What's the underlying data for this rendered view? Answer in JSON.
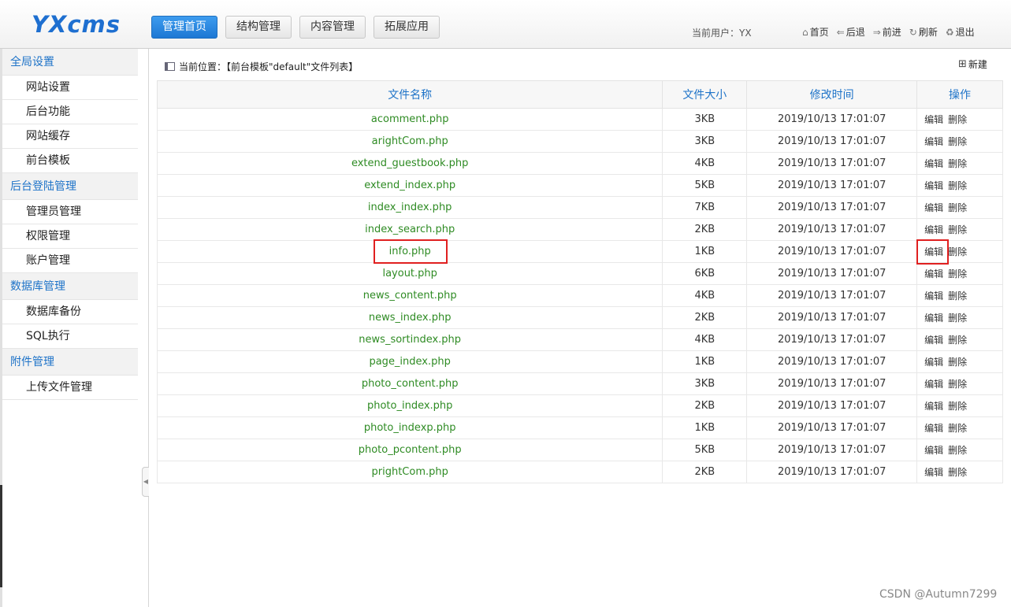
{
  "header": {
    "logo": "YXcms",
    "tabs": [
      "管理首页",
      "结构管理",
      "内容管理",
      "拓展应用"
    ],
    "current_user": "当前用户：YX",
    "toolbar": [
      {
        "icon": "home-icon",
        "glyph": "⌂",
        "label": "首页"
      },
      {
        "icon": "back-icon",
        "glyph": "⇐",
        "label": "后退"
      },
      {
        "icon": "forward-icon",
        "glyph": "⇒",
        "label": "前进"
      },
      {
        "icon": "refresh-icon",
        "glyph": "↻",
        "label": "刷新"
      },
      {
        "icon": "logout-icon",
        "glyph": "♻",
        "label": "退出"
      }
    ]
  },
  "sidebar": [
    {
      "group": "全局设置",
      "items": [
        "网站设置",
        "后台功能",
        "网站缓存",
        "前台模板"
      ]
    },
    {
      "group": "后台登陆管理",
      "items": [
        "管理员管理",
        "权限管理",
        "账户管理"
      ]
    },
    {
      "group": "数据库管理",
      "items": [
        "数据库备份",
        "SQL执行"
      ]
    },
    {
      "group": "附件管理",
      "items": [
        "上传文件管理"
      ]
    }
  ],
  "breadcrumb": "当前位置：【前台模板\"default\"文件列表】",
  "new_button": "新建",
  "table": {
    "headers": [
      "文件名称",
      "文件大小",
      "修改时间",
      "操作"
    ],
    "edit_label": "编辑",
    "delete_label": "删除",
    "rows": [
      {
        "name": "acomment.php",
        "size": "3KB",
        "time": "2019/10/13 17:01:07"
      },
      {
        "name": "arightCom.php",
        "size": "3KB",
        "time": "2019/10/13 17:01:07"
      },
      {
        "name": "extend_guestbook.php",
        "size": "4KB",
        "time": "2019/10/13 17:01:07"
      },
      {
        "name": "extend_index.php",
        "size": "5KB",
        "time": "2019/10/13 17:01:07"
      },
      {
        "name": "index_index.php",
        "size": "7KB",
        "time": "2019/10/13 17:01:07"
      },
      {
        "name": "index_search.php",
        "size": "2KB",
        "time": "2019/10/13 17:01:07"
      },
      {
        "name": "info.php",
        "size": "1KB",
        "time": "2019/10/13 17:01:07"
      },
      {
        "name": "layout.php",
        "size": "6KB",
        "time": "2019/10/13 17:01:07"
      },
      {
        "name": "news_content.php",
        "size": "4KB",
        "time": "2019/10/13 17:01:07"
      },
      {
        "name": "news_index.php",
        "size": "2KB",
        "time": "2019/10/13 17:01:07"
      },
      {
        "name": "news_sortindex.php",
        "size": "4KB",
        "time": "2019/10/13 17:01:07"
      },
      {
        "name": "page_index.php",
        "size": "1KB",
        "time": "2019/10/13 17:01:07"
      },
      {
        "name": "photo_content.php",
        "size": "3KB",
        "time": "2019/10/13 17:01:07"
      },
      {
        "name": "photo_index.php",
        "size": "2KB",
        "time": "2019/10/13 17:01:07"
      },
      {
        "name": "photo_indexp.php",
        "size": "1KB",
        "time": "2019/10/13 17:01:07"
      },
      {
        "name": "photo_pcontent.php",
        "size": "5KB",
        "time": "2019/10/13 17:01:07"
      },
      {
        "name": "prightCom.php",
        "size": "2KB",
        "time": "2019/10/13 17:01:07"
      }
    ]
  },
  "watermark": "CSDN @Autumn7299",
  "colors": {
    "accent": "#1e73c8",
    "file_link": "#2e8b23",
    "highlight": "#e02020"
  }
}
